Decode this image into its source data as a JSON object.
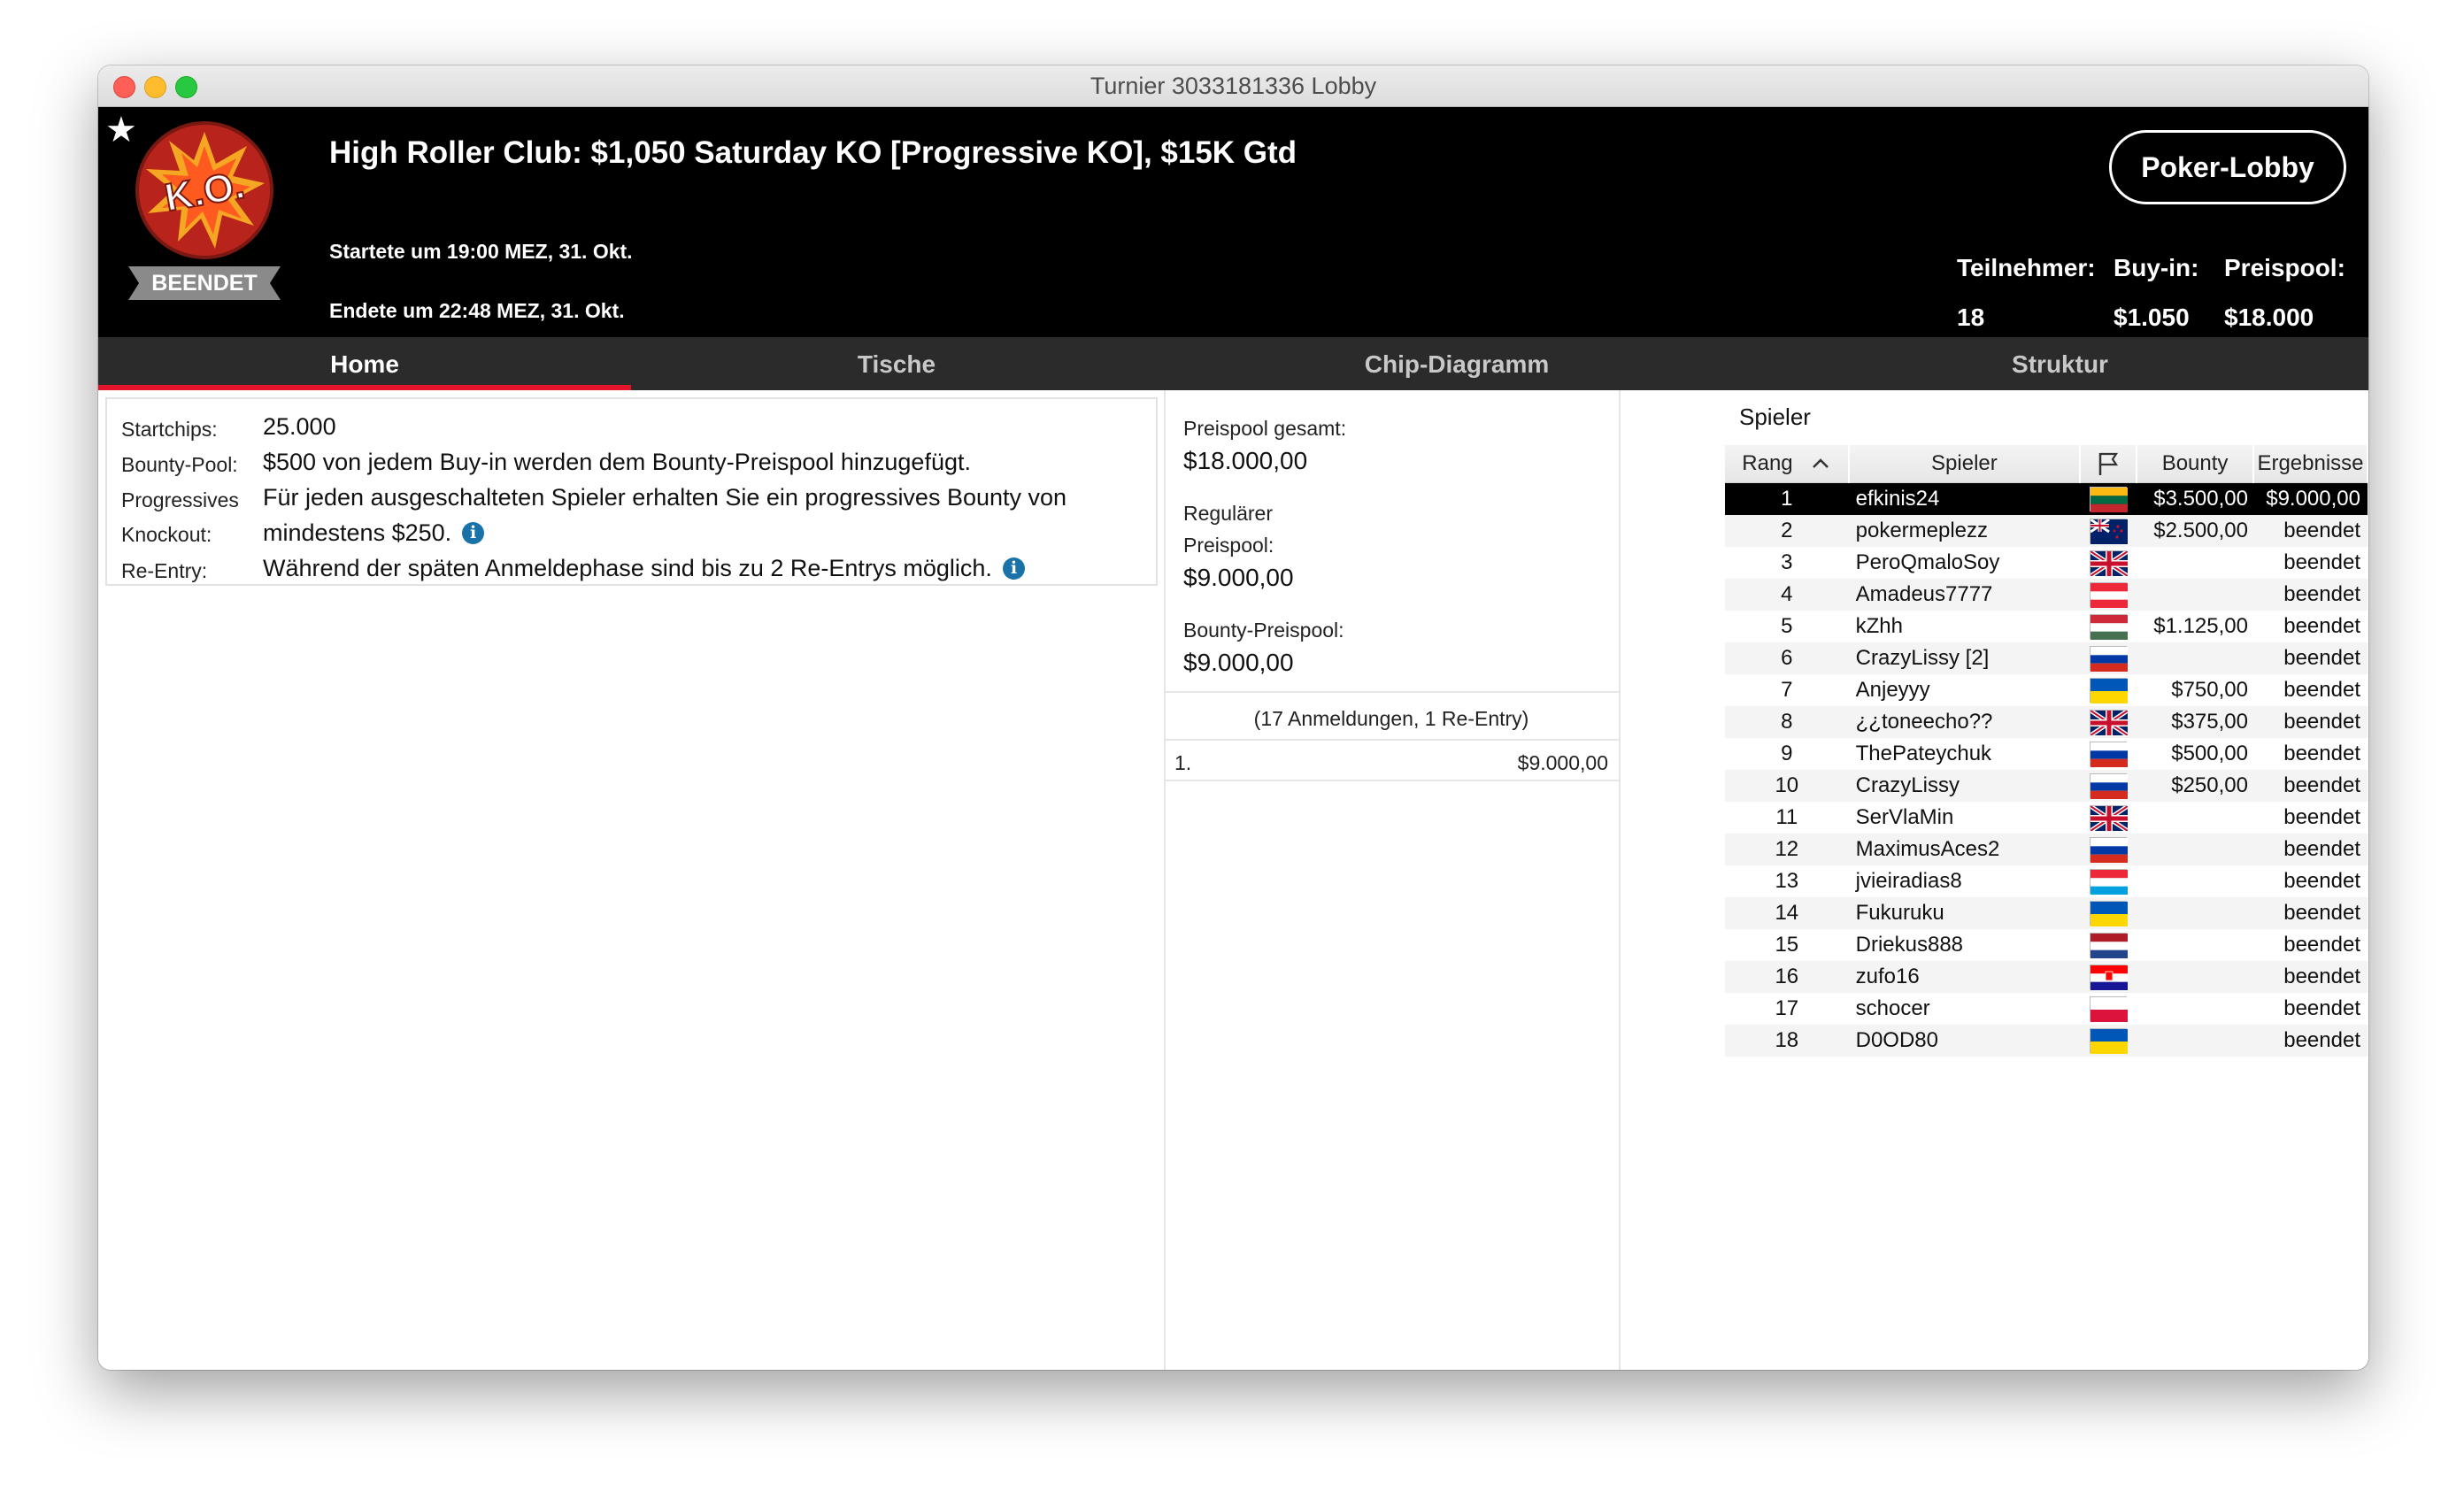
{
  "window": {
    "title": "Turnier 3033181336 Lobby"
  },
  "header": {
    "tournament_name": "High Roller Club: $1,050 Saturday KO [Progressive KO], $15K Gtd",
    "started": "Startete um 19:00 MEZ, 31. Okt.",
    "ended": "Endete um 22:48 MEZ, 31. Okt.",
    "status_badge": "BEENDET",
    "logo_text": "K.O.",
    "lobby_button": "Poker-Lobby",
    "stats": [
      {
        "label": "Teilnehmer:",
        "value": "18"
      },
      {
        "label": "Buy-in:",
        "value": "$1.050"
      },
      {
        "label": "Preispool:",
        "value": "$18.000"
      }
    ]
  },
  "tabs": [
    {
      "label": "Home",
      "active": true
    },
    {
      "label": "Tische",
      "active": false
    },
    {
      "label": "Chip-Diagramm",
      "active": false
    },
    {
      "label": "Struktur",
      "active": false
    }
  ],
  "info": {
    "startchips_label": "Startchips:",
    "startchips_value": "25.000",
    "bounty_pool_label": "Bounty-Pool:",
    "bounty_pool_value": "$500 von jedem Buy-in werden dem Bounty-Preispool hinzugefügt.",
    "progressive_label_1": "Progressives",
    "progressive_label_2": "Knockout:",
    "progressive_value_1": "Für jeden ausgeschalteten Spieler erhalten Sie ein progressives Bounty von",
    "progressive_value_2": "mindestens $250.",
    "reentry_label": "Re-Entry:",
    "reentry_value": "Während der späten Anmeldephase sind bis zu 2 Re-Entrys möglich."
  },
  "prizepool": {
    "total_label": "Preispool gesamt:",
    "total_value": "$18.000,00",
    "regular_label_1": "Regulärer",
    "regular_label_2": "Preispool:",
    "regular_value": "$9.000,00",
    "bounty_label": "Bounty-Preispool:",
    "bounty_value": "$9.000,00",
    "registrations": "(17 Anmeldungen, 1 Re-Entry)",
    "payouts": [
      {
        "place": "1.",
        "amount": "$9.000,00"
      }
    ]
  },
  "players": {
    "title": "Spieler",
    "columns": {
      "rank": "Rang",
      "player": "Spieler",
      "bounty": "Bounty",
      "results": "Ergebnisse"
    },
    "rows": [
      {
        "rank": "1",
        "name": "efkinis24",
        "flag": "LT",
        "bounty": "$3.500,00",
        "result": "$9.000,00"
      },
      {
        "rank": "2",
        "name": "pokermeplezz",
        "flag": "NZ",
        "bounty": "$2.500,00",
        "result": "beendet"
      },
      {
        "rank": "3",
        "name": "PeroQmaloSoy",
        "flag": "GB",
        "bounty": "",
        "result": "beendet"
      },
      {
        "rank": "4",
        "name": "Amadeus7777",
        "flag": "AT",
        "bounty": "",
        "result": "beendet"
      },
      {
        "rank": "5",
        "name": "kZhh",
        "flag": "HU",
        "bounty": "$1.125,00",
        "result": "beendet"
      },
      {
        "rank": "6",
        "name": "CrazyLissy [2]",
        "flag": "RU",
        "bounty": "",
        "result": "beendet"
      },
      {
        "rank": "7",
        "name": "Anjeyyy",
        "flag": "UA",
        "bounty": "$750,00",
        "result": "beendet"
      },
      {
        "rank": "8",
        "name": "¿¿toneecho??",
        "flag": "GB",
        "bounty": "$375,00",
        "result": "beendet"
      },
      {
        "rank": "9",
        "name": "ThePateychuk",
        "flag": "RU",
        "bounty": "$500,00",
        "result": "beendet"
      },
      {
        "rank": "10",
        "name": "CrazyLissy",
        "flag": "RU",
        "bounty": "$250,00",
        "result": "beendet"
      },
      {
        "rank": "11",
        "name": "SerVlaMin",
        "flag": "GB",
        "bounty": "",
        "result": "beendet"
      },
      {
        "rank": "12",
        "name": "MaximusAces2",
        "flag": "RU",
        "bounty": "",
        "result": "beendet"
      },
      {
        "rank": "13",
        "name": "jvieiradias8",
        "flag": "LU",
        "bounty": "",
        "result": "beendet"
      },
      {
        "rank": "14",
        "name": "Fukuruku",
        "flag": "UA",
        "bounty": "",
        "result": "beendet"
      },
      {
        "rank": "15",
        "name": "Driekus888",
        "flag": "NL",
        "bounty": "",
        "result": "beendet"
      },
      {
        "rank": "16",
        "name": "zufo16",
        "flag": "HR",
        "bounty": "",
        "result": "beendet"
      },
      {
        "rank": "17",
        "name": "schocer",
        "flag": "PL",
        "bounty": "",
        "result": "beendet"
      },
      {
        "rank": "18",
        "name": "D0OD80",
        "flag": "UA",
        "bounty": "",
        "result": "beendet"
      }
    ]
  },
  "colors": {
    "accent": "#e4152b",
    "header_bg": "#000000",
    "tabbar_bg": "#2b2b2b",
    "info_icon": "#1a73a8"
  }
}
